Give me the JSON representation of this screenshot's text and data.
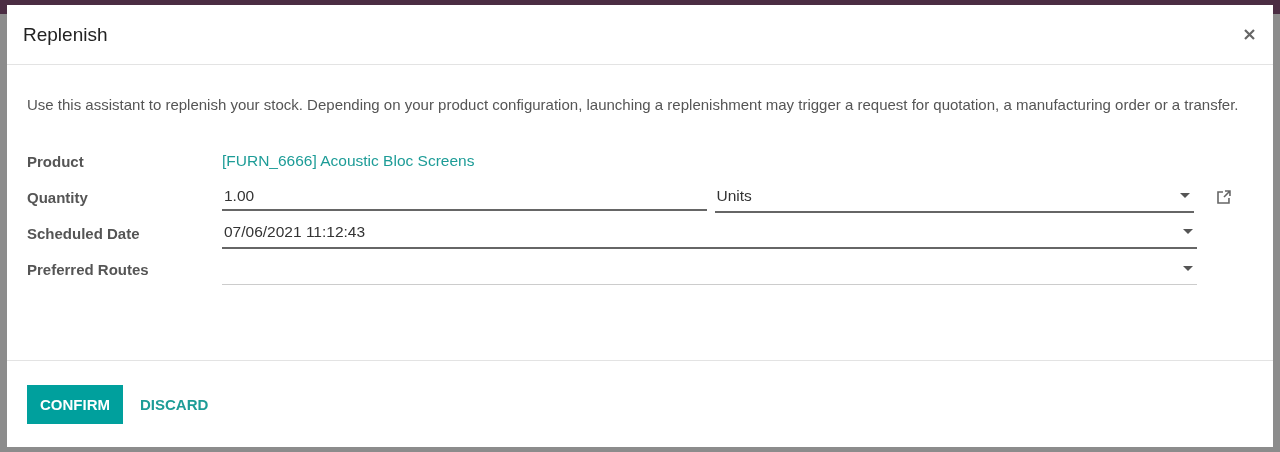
{
  "dialog": {
    "title": "Replenish"
  },
  "description": "Use this assistant to replenish your stock. Depending on your product configuration, launching a replenishment may trigger a request for quotation, a manufacturing order or a transfer.",
  "fields": [
    {
      "label": "Product",
      "kind": "link",
      "value": "[FURN_6666] Acoustic Bloc Screens"
    },
    {
      "label": "Quantity",
      "kind": "quantity",
      "value": "1.00",
      "unit": "Units",
      "required": true
    },
    {
      "label": "Scheduled Date",
      "kind": "date",
      "value": "07/06/2021 11:12:43",
      "required": true
    },
    {
      "label": "Preferred Routes",
      "kind": "select",
      "required": false
    }
  ],
  "buttons": [
    {
      "label": "CONFIRM",
      "kind": "primary"
    },
    {
      "label": "DISCARD",
      "kind": "secondary"
    }
  ]
}
